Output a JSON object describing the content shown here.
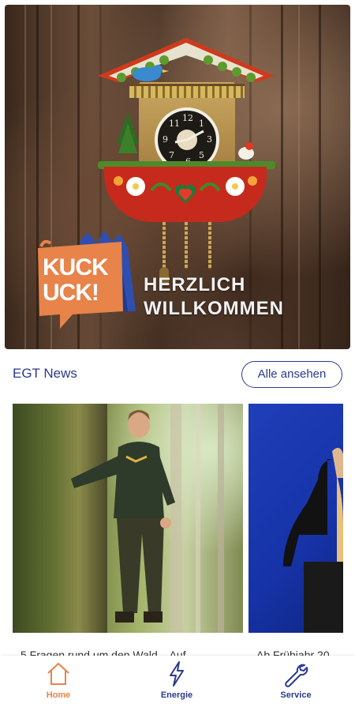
{
  "hero": {
    "logo_line1": "KUCK",
    "logo_line2": "UCK!",
    "headline_line1": "HERZLICH",
    "headline_line2": "WILLKOMMEN"
  },
  "news": {
    "title": "EGT News",
    "see_all_label": "Alle ansehen",
    "cards": [
      {
        "caption": "5 Fragen rund um den Wald – Auf"
      },
      {
        "caption": "Ab Frühjahr 20"
      }
    ]
  },
  "bottom_nav": {
    "items": [
      {
        "label": "Home",
        "icon": "home-icon",
        "active": true
      },
      {
        "label": "Energie",
        "icon": "lightning-icon",
        "active": false
      },
      {
        "label": "Service",
        "icon": "wrench-icon",
        "active": false
      }
    ]
  },
  "colors": {
    "accent": "#e8834a",
    "brand_blue": "#2b3a8c"
  }
}
